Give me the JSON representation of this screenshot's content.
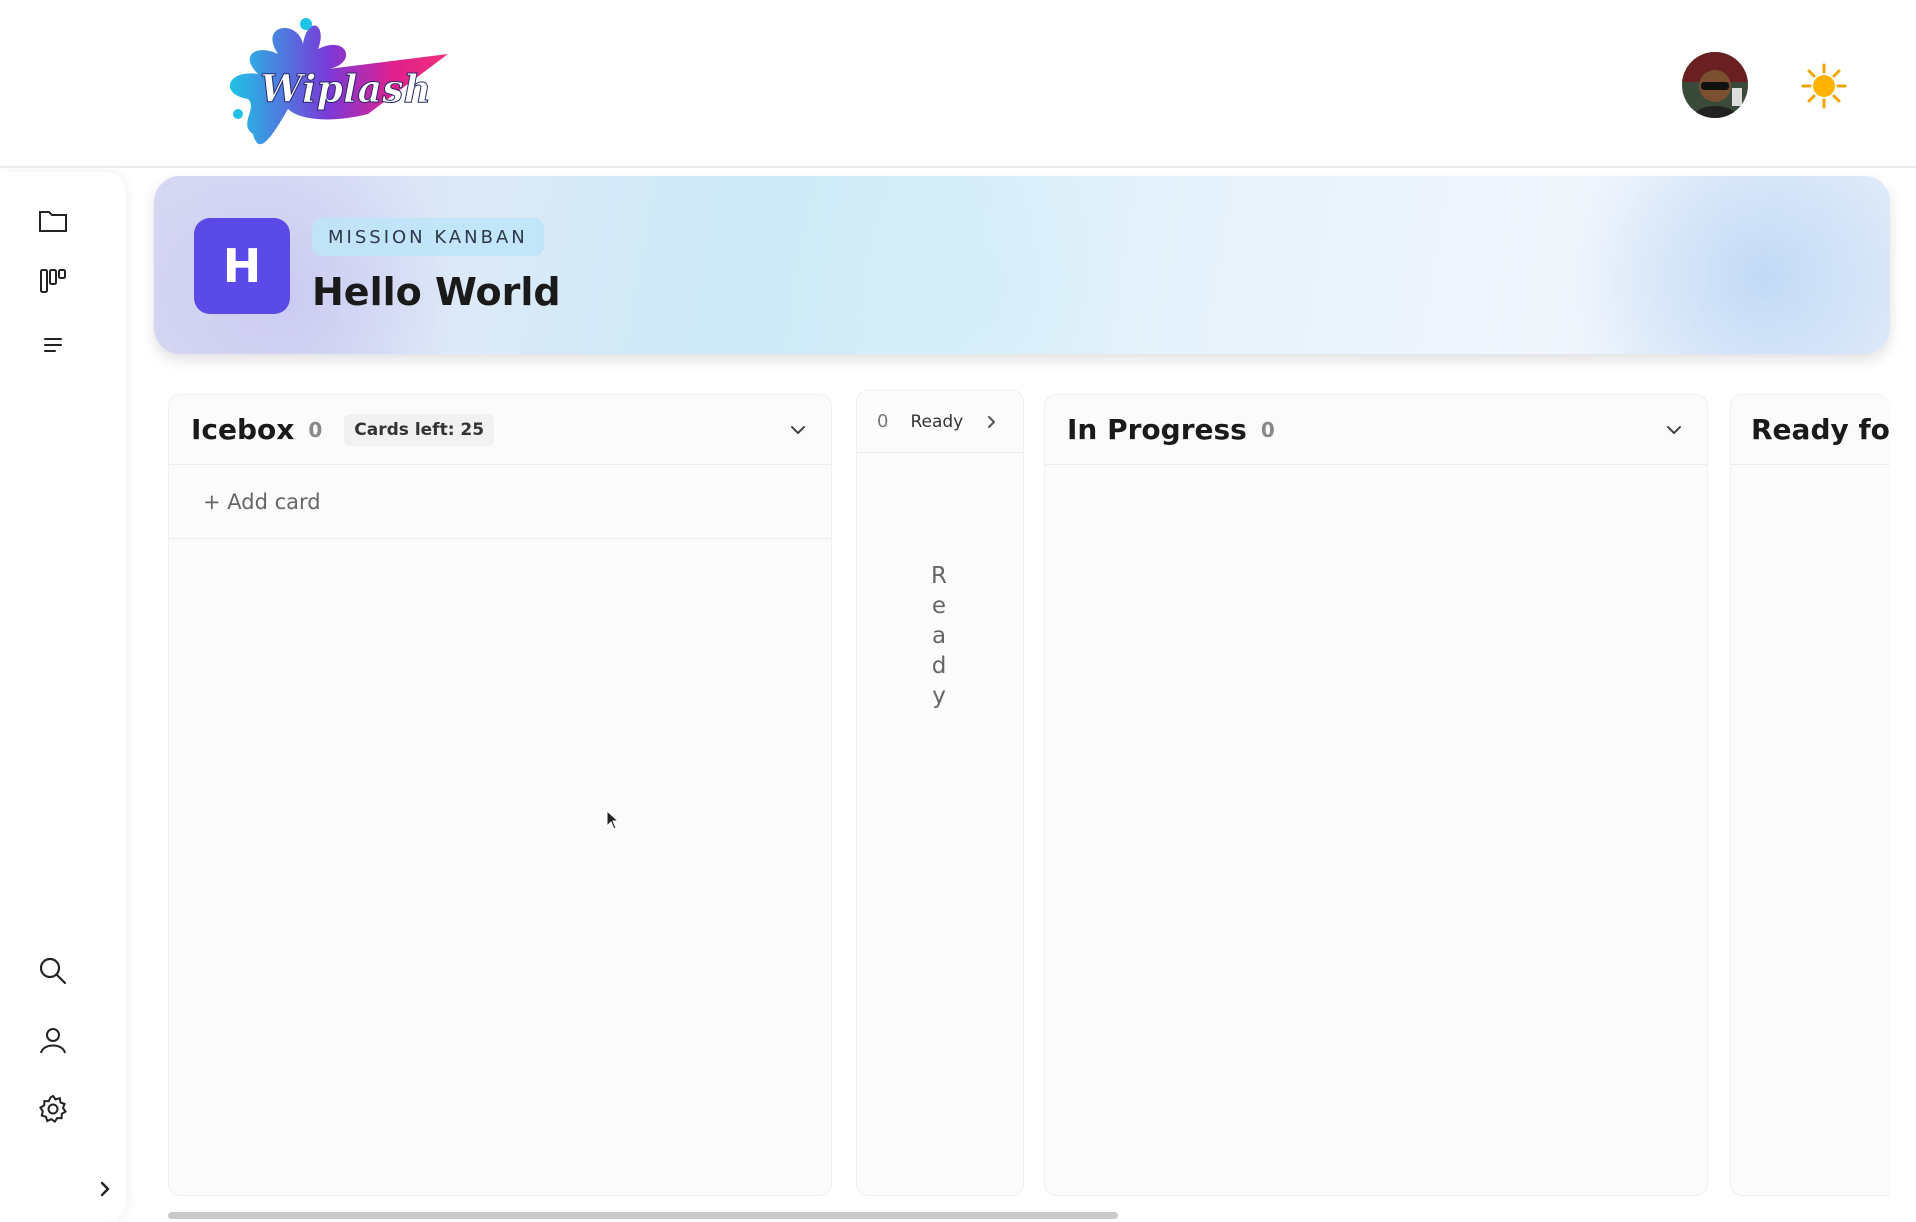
{
  "app": {
    "logo_text": "Wiplash"
  },
  "sidebar": {
    "items": [
      {
        "name": "projects",
        "icon": "folder-icon"
      },
      {
        "name": "kanban",
        "icon": "kanban-icon"
      },
      {
        "name": "list",
        "icon": "list-icon"
      },
      {
        "name": "search",
        "icon": "search-icon"
      },
      {
        "name": "profile",
        "icon": "user-icon"
      },
      {
        "name": "settings",
        "icon": "gear-icon"
      }
    ],
    "expand_icon": "chevron-right-icon"
  },
  "banner": {
    "badge_letter": "H",
    "tag": "MISSION KANBAN",
    "title": "Hello World",
    "badge_color": "#5a4be8"
  },
  "columns": [
    {
      "title": "Icebox",
      "count": "0",
      "cards_left": "Cards left: 25",
      "add_card": "+ Add card"
    },
    {
      "title": "Ready",
      "count": "0",
      "vertical": "Ready",
      "collapsed": true
    },
    {
      "title": "In Progress",
      "count": "0"
    },
    {
      "title": "Ready for y",
      "count": ""
    }
  ],
  "header": {
    "avatar_icon": "avatar",
    "theme_icon": "sun-icon"
  }
}
